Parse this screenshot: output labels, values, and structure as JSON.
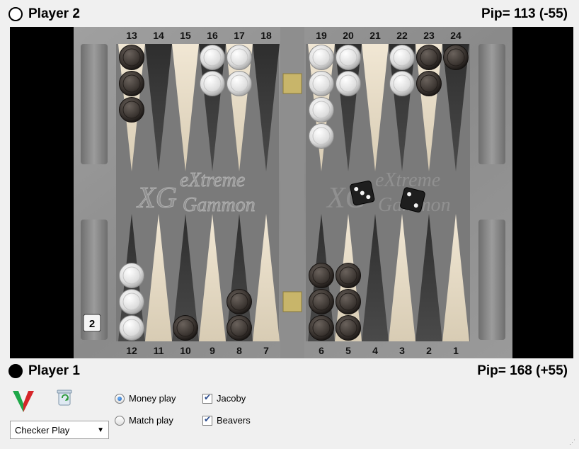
{
  "player2": {
    "name": "Player 2",
    "pip": "Pip= 113 (-55)",
    "checker_color": "white"
  },
  "player1": {
    "name": "Player 1",
    "pip": "Pip= 168 (+55)",
    "checker_color": "black"
  },
  "top_point_numbers": [
    "13",
    "14",
    "15",
    "16",
    "17",
    "18",
    "19",
    "20",
    "21",
    "22",
    "23",
    "24"
  ],
  "bottom_point_numbers": [
    "12",
    "11",
    "10",
    "9",
    "8",
    "7",
    "6",
    "5",
    "4",
    "3",
    "2",
    "1"
  ],
  "cube_value": "2",
  "board_logo": {
    "monogram": "XG",
    "line1": "eXtreme",
    "line2": "Gammon"
  },
  "positions": {
    "13": {
      "color": "black",
      "count": 3
    },
    "16": {
      "color": "white",
      "count": 2
    },
    "17": {
      "color": "white",
      "count": 2
    },
    "19": {
      "color": "white",
      "count": 4
    },
    "20": {
      "color": "white",
      "count": 2
    },
    "22": {
      "color": "white",
      "count": 2
    },
    "23": {
      "color": "black",
      "count": 2
    },
    "24": {
      "color": "black",
      "count": 1
    },
    "12": {
      "color": "white",
      "count": 3
    },
    "10": {
      "color": "black",
      "count": 1
    },
    "8": {
      "color": "black",
      "count": 2
    },
    "6": {
      "color": "black",
      "count": 3
    },
    "5": {
      "color": "black",
      "count": 3
    }
  },
  "dice": [
    {
      "value": 3,
      "color": "black"
    },
    {
      "value": 2,
      "color": "black"
    }
  ],
  "controls": {
    "mode_select": "Checker Play",
    "money_play": {
      "label": "Money play",
      "selected": true
    },
    "match_play": {
      "label": "Match play",
      "selected": false
    },
    "jacoby": {
      "label": "Jacoby",
      "checked": true
    },
    "beavers": {
      "label": "Beavers",
      "checked": true
    }
  },
  "icons": {
    "app_logo": "xg-logo-icon",
    "clear": "recycle-bin-icon",
    "dropdown": "chevron-down-icon"
  },
  "colors": {
    "board_frame": "#8a8a8a",
    "board_felt": "#767676",
    "light_point": "#e8dcc6",
    "dark_point": "#3a3a3a",
    "white_checker": "#e6e6e6",
    "black_checker": "#3a3430",
    "outside": "#000000"
  }
}
